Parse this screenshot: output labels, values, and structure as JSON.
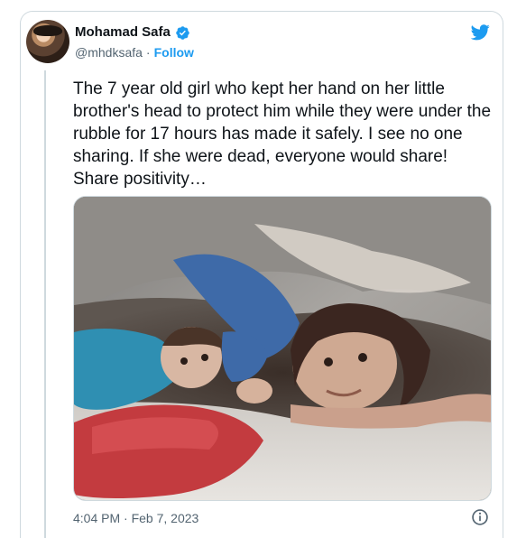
{
  "tweet": {
    "author_name": "Mohamad Safa",
    "handle": "@mhdksafa",
    "separator": "·",
    "follow_label": "Follow",
    "text": "The 7 year old girl who kept her hand on her little brother's head to protect him while they were under the rubble for 17 hours has made it safely. I see no one sharing. If she were dead, everyone would share! Share positivity…",
    "timestamp": "4:04 PM · Feb 7, 2023"
  },
  "icons": {
    "verified": "verified-badge-icon",
    "brand": "twitter-bird-icon",
    "info": "info-icon"
  },
  "colors": {
    "accent": "#1d9bf0",
    "text": "#0f1419",
    "secondary_text": "#536471",
    "border": "#cfd9de"
  }
}
